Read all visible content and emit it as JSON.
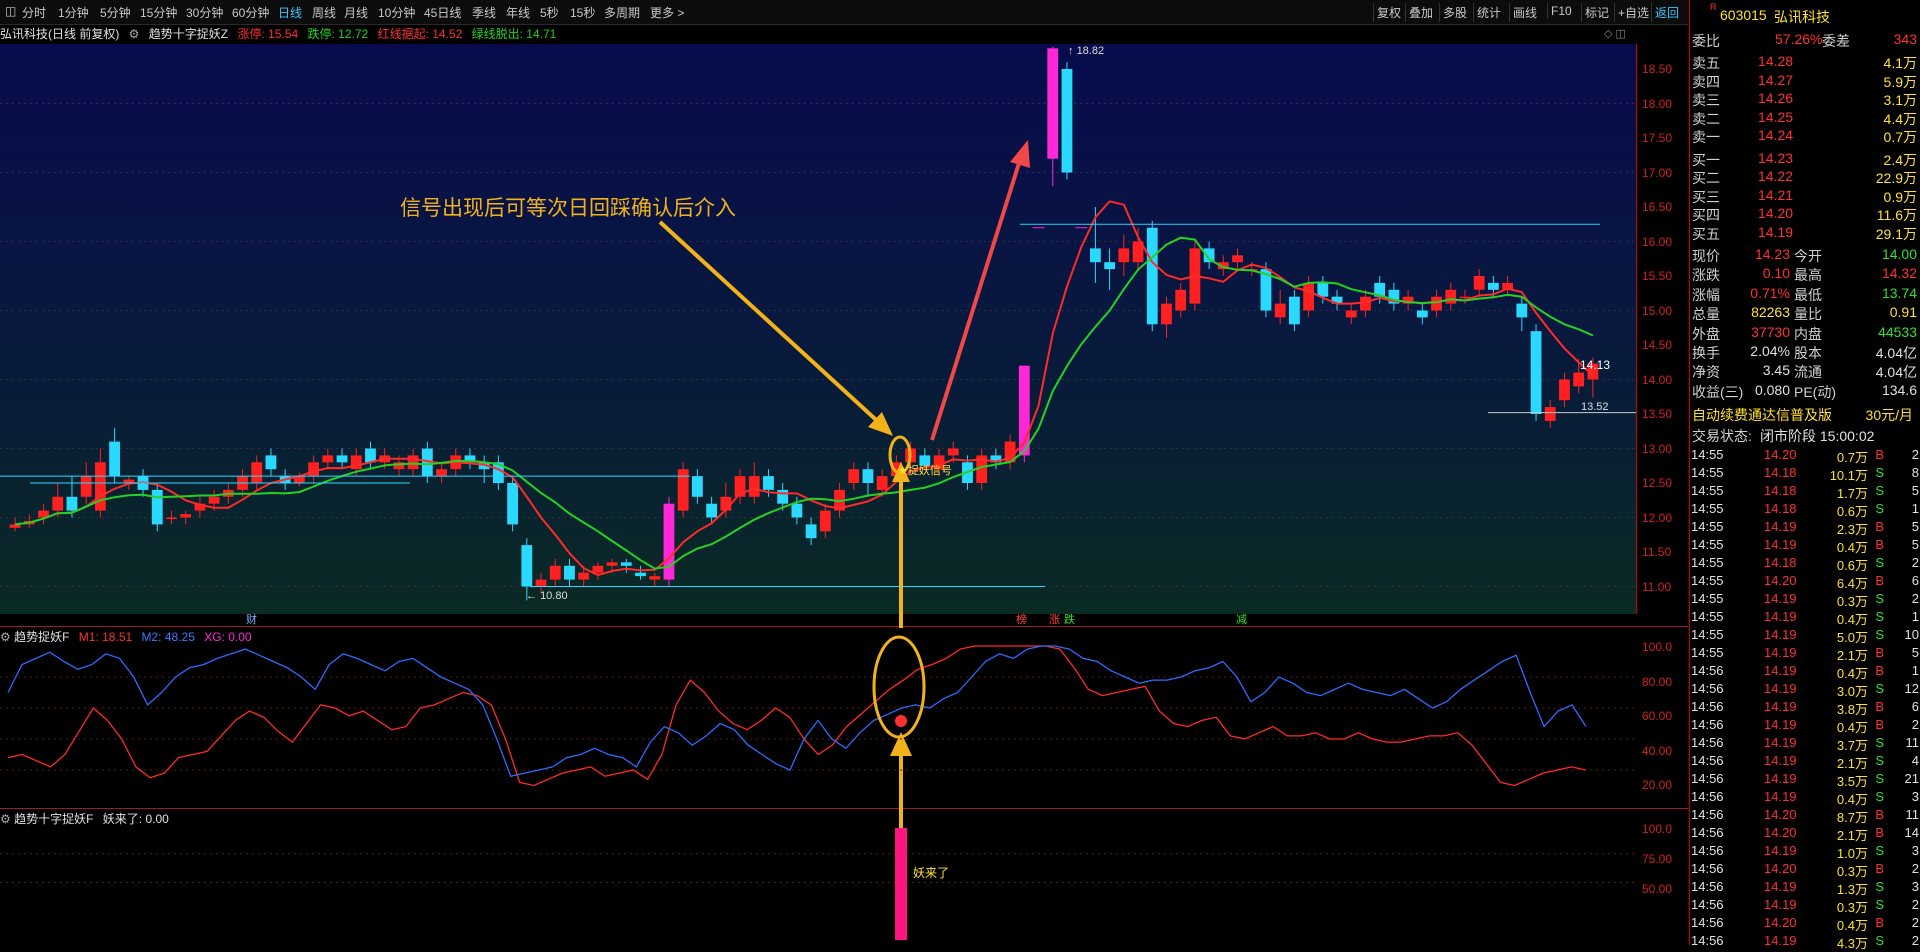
{
  "toolbar": {
    "periods": [
      "分时",
      "1分钟",
      "5分钟",
      "15分钟",
      "30分钟",
      "60分钟",
      "日线",
      "周线",
      "月线",
      "10分钟",
      "45日线",
      "季线",
      "年线",
      "5秒",
      "15秒",
      "多周期",
      "更多 >"
    ],
    "active_period": "日线",
    "tools": [
      "复权",
      "叠加",
      "多股",
      "统计",
      "画线",
      "F10",
      "标记",
      "+自选",
      "返回"
    ],
    "active_tool": "返回"
  },
  "info_line": {
    "title": "弘讯科技(日线 前复权)",
    "indicator": "趋势十字捉妖Z",
    "limit_up": "涨停: 15.54",
    "limit_down": "跌停: 12.72",
    "red_line": "红线据起: 14.52",
    "green_line": "绿线脱出: 14.71"
  },
  "main_axis": [
    "18.50",
    "18.00",
    "17.50",
    "17.00",
    "16.50",
    "16.00",
    "15.50",
    "15.00",
    "14.50",
    "14.00",
    "13.50",
    "13.00",
    "12.50",
    "12.00",
    "11.50",
    "11.00"
  ],
  "chart_annotations": {
    "high_label": "18.82",
    "low_label": "10.80",
    "last_price": "14.13",
    "level_label": "13.52",
    "signal_text": "信号出现后可等次日回踩确认后介入",
    "signal_tag": "★捉妖信号",
    "bottom_tags": [
      "财",
      "榜",
      "涨",
      "跌",
      "减"
    ]
  },
  "indicator1": {
    "name": "趋势捉妖F",
    "m1": "M1: 18.51",
    "m2": "M2: 48.25",
    "xg": "XG: 0.00",
    "axis": [
      "100.0",
      "80.00",
      "60.00",
      "40.00",
      "20.00"
    ]
  },
  "indicator2": {
    "name": "趋势十字捉妖F",
    "value": "妖来了: 0.00",
    "bar_label": "妖来了",
    "axis": [
      "100.0",
      "75.00",
      "50.00"
    ]
  },
  "quote": {
    "code": "603015",
    "name": "弘讯科技",
    "ratio_label": "委比",
    "ratio_value": "57.26%",
    "diff_label": "委差",
    "diff_value": "343",
    "asks": [
      {
        "label": "卖五",
        "price": "14.28",
        "vol": "4.1万"
      },
      {
        "label": "卖四",
        "price": "14.27",
        "vol": "5.9万"
      },
      {
        "label": "卖三",
        "price": "14.26",
        "vol": "3.1万"
      },
      {
        "label": "卖二",
        "price": "14.25",
        "vol": "4.4万"
      },
      {
        "label": "卖一",
        "price": "14.24",
        "vol": "0.7万"
      }
    ],
    "bids": [
      {
        "label": "买一",
        "price": "14.23",
        "vol": "2.4万"
      },
      {
        "label": "买二",
        "price": "14.22",
        "vol": "22.9万"
      },
      {
        "label": "买三",
        "price": "14.21",
        "vol": "0.9万"
      },
      {
        "label": "买四",
        "price": "14.20",
        "vol": "11.6万"
      },
      {
        "label": "买五",
        "price": "14.19",
        "vol": "29.1万"
      }
    ],
    "stats": [
      {
        "l1": "现价",
        "v1": "14.23",
        "l2": "今开",
        "v2": "14.00"
      },
      {
        "l1": "涨跌",
        "v1": "0.10",
        "l2": "最高",
        "v2": "14.32"
      },
      {
        "l1": "涨幅",
        "v1": "0.71%",
        "l2": "最低",
        "v2": "13.74"
      },
      {
        "l1": "总量",
        "v1": "82263",
        "l2": "量比",
        "v2": "0.91"
      },
      {
        "l1": "外盘",
        "v1": "37730",
        "l2": "内盘",
        "v2": "44533"
      },
      {
        "l1": "换手",
        "v1": "2.04%",
        "l2": "股本",
        "v2": "4.04亿"
      },
      {
        "l1": "净资",
        "v1": "3.45",
        "l2": "流通",
        "v2": "4.04亿"
      },
      {
        "l1": "收益(三)",
        "v1": "0.080",
        "l2": "PE(动)",
        "v2": "134.6"
      }
    ],
    "ad_text": "自动续费通达信普及版",
    "ad_price": "30元/月",
    "status_label": "交易状态:",
    "status_value": "闭市阶段 15:00:02"
  },
  "ticks": [
    {
      "t": "14:55",
      "p": "14.20",
      "v": "0.7万",
      "s": "B",
      "n": "2"
    },
    {
      "t": "14:55",
      "p": "14.18",
      "v": "10.1万",
      "s": "S",
      "n": "8"
    },
    {
      "t": "14:55",
      "p": "14.18",
      "v": "1.7万",
      "s": "S",
      "n": "5"
    },
    {
      "t": "14:55",
      "p": "14.18",
      "v": "0.6万",
      "s": "S",
      "n": "1"
    },
    {
      "t": "14:55",
      "p": "14.19",
      "v": "2.3万",
      "s": "B",
      "n": "5"
    },
    {
      "t": "14:55",
      "p": "14.19",
      "v": "0.4万",
      "s": "B",
      "n": "5"
    },
    {
      "t": "14:55",
      "p": "14.18",
      "v": "0.6万",
      "s": "S",
      "n": "2"
    },
    {
      "t": "14:55",
      "p": "14.20",
      "v": "6.4万",
      "s": "B",
      "n": "6"
    },
    {
      "t": "14:55",
      "p": "14.19",
      "v": "0.3万",
      "s": "S",
      "n": "2"
    },
    {
      "t": "14:55",
      "p": "14.19",
      "v": "0.4万",
      "s": "S",
      "n": "1"
    },
    {
      "t": "14:55",
      "p": "14.19",
      "v": "5.0万",
      "s": "S",
      "n": "10"
    },
    {
      "t": "14:55",
      "p": "14.19",
      "v": "2.1万",
      "s": "B",
      "n": "5"
    },
    {
      "t": "14:56",
      "p": "14.19",
      "v": "0.4万",
      "s": "B",
      "n": "1"
    },
    {
      "t": "14:56",
      "p": "14.19",
      "v": "3.0万",
      "s": "S",
      "n": "12"
    },
    {
      "t": "14:56",
      "p": "14.19",
      "v": "3.8万",
      "s": "B",
      "n": "6"
    },
    {
      "t": "14:56",
      "p": "14.19",
      "v": "0.4万",
      "s": "B",
      "n": "2"
    },
    {
      "t": "14:56",
      "p": "14.19",
      "v": "3.7万",
      "s": "S",
      "n": "11"
    },
    {
      "t": "14:56",
      "p": "14.19",
      "v": "2.1万",
      "s": "S",
      "n": "4"
    },
    {
      "t": "14:56",
      "p": "14.19",
      "v": "3.5万",
      "s": "S",
      "n": "21"
    },
    {
      "t": "14:56",
      "p": "14.19",
      "v": "0.4万",
      "s": "S",
      "n": "3"
    },
    {
      "t": "14:56",
      "p": "14.20",
      "v": "8.7万",
      "s": "B",
      "n": "11"
    },
    {
      "t": "14:56",
      "p": "14.20",
      "v": "2.1万",
      "s": "B",
      "n": "14"
    },
    {
      "t": "14:56",
      "p": "14.19",
      "v": "1.0万",
      "s": "S",
      "n": "3"
    },
    {
      "t": "14:56",
      "p": "14.20",
      "v": "0.3万",
      "s": "B",
      "n": "2"
    },
    {
      "t": "14:56",
      "p": "14.19",
      "v": "1.3万",
      "s": "S",
      "n": "3"
    },
    {
      "t": "14:56",
      "p": "14.19",
      "v": "0.3万",
      "s": "S",
      "n": "2"
    },
    {
      "t": "14:56",
      "p": "14.20",
      "v": "0.4万",
      "s": "B",
      "n": "2"
    },
    {
      "t": "14:56",
      "p": "14.19",
      "v": "4.3万",
      "s": "S",
      "n": "2"
    }
  ],
  "colors": {
    "up": "#ff2020",
    "down": "#2ad9ff",
    "ma_red": "#ff2a2a",
    "ma_green": "#25d125",
    "arrow": "#f2b31a",
    "magenta": "#ff27d8"
  }
}
